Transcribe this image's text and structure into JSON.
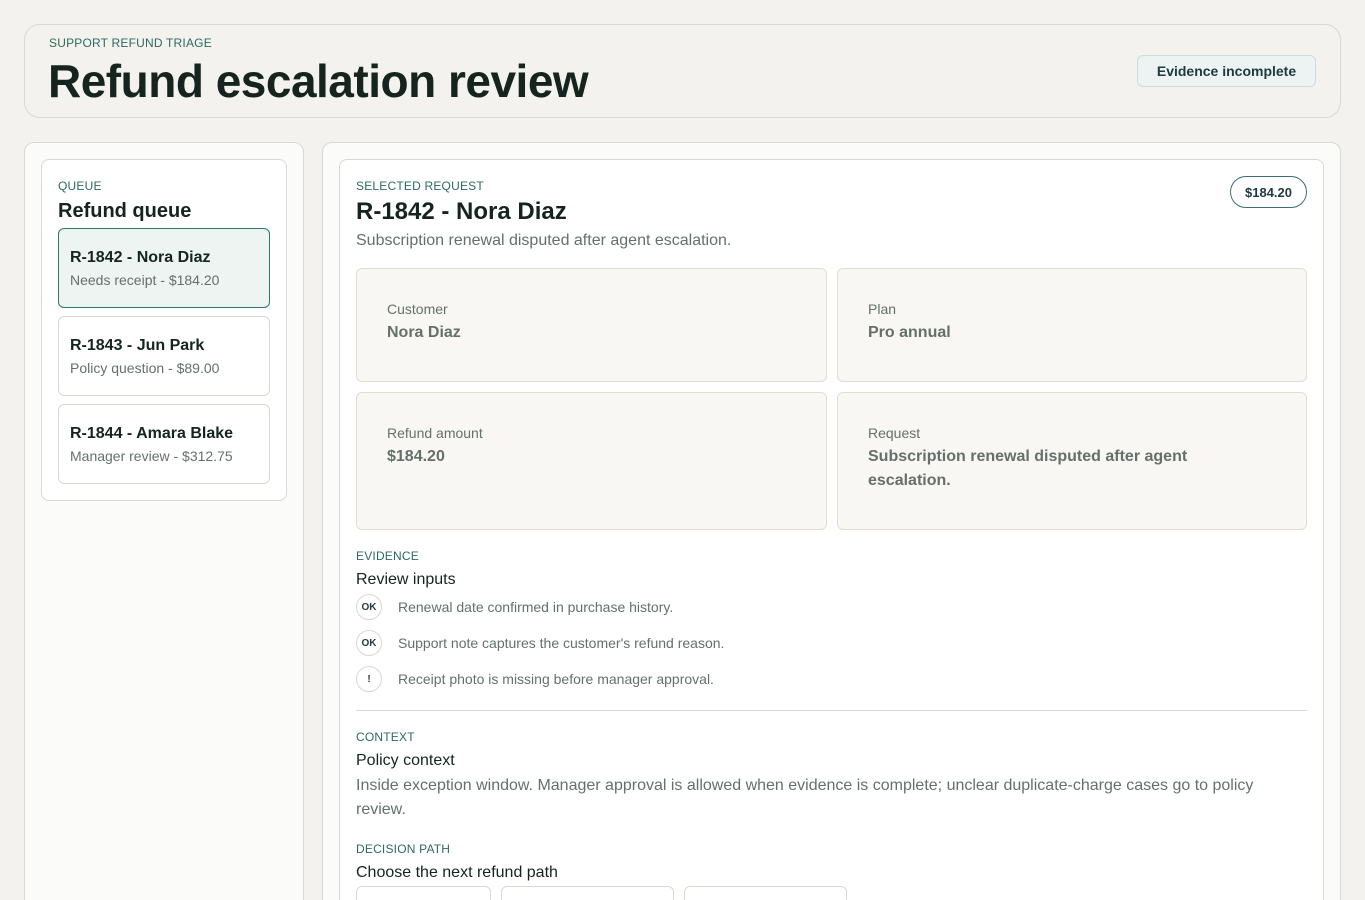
{
  "header": {
    "eyebrow": "SUPPORT REFUND TRIAGE",
    "title": "Refund escalation review",
    "status_badge": "Evidence incomplete"
  },
  "queue": {
    "eyebrow": "QUEUE",
    "title": "Refund queue",
    "items": [
      {
        "title": "R-1842 - Nora Diaz",
        "subtitle": "Needs receipt - $184.20",
        "active": true
      },
      {
        "title": "R-1843 - Jun Park",
        "subtitle": "Policy question - $89.00",
        "active": false
      },
      {
        "title": "R-1844 - Amara Blake",
        "subtitle": "Manager review - $312.75",
        "active": false
      }
    ]
  },
  "detail": {
    "eyebrow": "SELECTED REQUEST",
    "title": "R-1842 - Nora Diaz",
    "summary": "Subscription renewal disputed after agent escalation.",
    "amount_pill": "$184.20",
    "fields": [
      {
        "label": "Customer",
        "value": "Nora Diaz"
      },
      {
        "label": "Plan",
        "value": "Pro annual"
      },
      {
        "label": "Refund amount",
        "value": "$184.20"
      },
      {
        "label": "Request",
        "value": "Subscription renewal disputed after agent escalation."
      }
    ]
  },
  "evidence": {
    "eyebrow": "EVIDENCE",
    "title": "Review inputs",
    "items": [
      {
        "badge": "OK",
        "text": "Renewal date confirmed in purchase history."
      },
      {
        "badge": "OK",
        "text": "Support note captures the customer's refund reason."
      },
      {
        "badge": "!",
        "text": "Receipt photo is missing before manager approval."
      }
    ]
  },
  "context": {
    "eyebrow": "CONTEXT",
    "title": "Policy context",
    "text": "Inside exception window. Manager approval is allowed when evidence is complete; unclear duplicate-charge cases go to policy review."
  },
  "decision": {
    "eyebrow": "DECISION PATH",
    "title": "Choose the next refund path"
  }
}
